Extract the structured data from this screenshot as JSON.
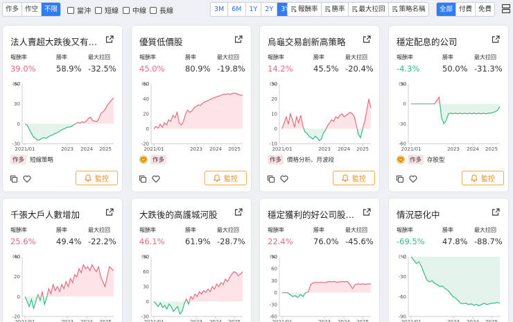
{
  "toolbar": {
    "direction": [
      {
        "label": "作多",
        "active": false
      },
      {
        "label": "作空",
        "active": false
      },
      {
        "label": "不限",
        "active": true
      }
    ],
    "terms": [
      "當沖",
      "短線",
      "中線",
      "長線"
    ],
    "periods": [
      {
        "label": "3M",
        "active": false
      },
      {
        "label": "6M",
        "active": false
      },
      {
        "label": "1Y",
        "active": false
      },
      {
        "label": "2Y",
        "active": false
      },
      {
        "label": "3Y",
        "active": true
      }
    ],
    "sorts": [
      "報酬率",
      "勝率",
      "最大拉回",
      "策略名稱"
    ],
    "pricing": [
      {
        "label": "全部",
        "active": true
      },
      {
        "label": "付費",
        "active": false
      },
      {
        "label": "免費",
        "active": false
      }
    ]
  },
  "labels": {
    "return": "報酬率",
    "winrate": "勝率",
    "drawdown": "最大拉回",
    "monitor": "監控",
    "unit": "(%)"
  },
  "colors": {
    "positive": "#e8697c",
    "negative": "#35b97e",
    "accent": "#2f7df6",
    "monitor": "#f4a742"
  },
  "cards": [
    {
      "title": "法人賣超大跌後又有法…",
      "return": "39.0%",
      "sign": "pos",
      "winrate": "58.9%",
      "drawdown": "-32.5%",
      "y_ticks": [
        "60",
        "30",
        "0",
        "-30"
      ],
      "y_range": [
        -30,
        60
      ],
      "x_ticks": [
        "2021/01",
        "2023",
        "2024",
        "2025"
      ],
      "series": [
        0,
        -2,
        -8,
        -14,
        -20,
        -22,
        -25,
        -24,
        -22,
        -21,
        -22,
        -20,
        -18,
        -17,
        -15,
        -14,
        -12,
        -10,
        -8,
        -7,
        -5,
        -5,
        -4,
        -2,
        0,
        2,
        1,
        3,
        2,
        4,
        8,
        10,
        5,
        4,
        3,
        8,
        16,
        18,
        22,
        28,
        32,
        36,
        39
      ],
      "tag": "作多",
      "tag_icon": false,
      "tag_desc": "短線策略"
    },
    {
      "title": "優質低價股",
      "return": "45.0%",
      "sign": "pos",
      "winrate": "80.9%",
      "drawdown": "-19.8%",
      "y_ticks": [
        "60",
        "40",
        "20",
        "0",
        "-20"
      ],
      "y_range": [
        -20,
        60
      ],
      "x_ticks": [
        "2021/01",
        "2023",
        "2024",
        "2025"
      ],
      "series": [
        0,
        3,
        1,
        6,
        2,
        8,
        5,
        12,
        10,
        18,
        15,
        22,
        8,
        5,
        10,
        20,
        25,
        22,
        24,
        28,
        30,
        32,
        31,
        34,
        36,
        37,
        38,
        40,
        41,
        42,
        43,
        44,
        45,
        46,
        46,
        47,
        46,
        47,
        48,
        47,
        46,
        45,
        45
      ],
      "tag": "作多",
      "tag_icon": true,
      "tag_desc": ""
    },
    {
      "title": "烏龜交易創新高策略",
      "return": "14.2%",
      "sign": "pos",
      "winrate": "45.5%",
      "drawdown": "-20.4%",
      "y_ticks": [
        "30",
        "20",
        "10",
        "0",
        "-10"
      ],
      "y_range": [
        -10,
        30
      ],
      "x_ticks": [
        "2021/01",
        "2023",
        "2024",
        "2025"
      ],
      "series": [
        0,
        4,
        8,
        3,
        10,
        6,
        1,
        8,
        4,
        9,
        2,
        -2,
        -3,
        -5,
        -6,
        -7,
        -5,
        -6,
        -8,
        -7,
        -3,
        -1,
        2,
        4,
        6,
        5,
        8,
        7,
        9,
        10,
        8,
        9,
        10,
        11,
        10,
        8,
        2,
        -4,
        -6,
        0,
        5,
        12,
        20,
        14
      ],
      "tag": "作多",
      "tag_icon": false,
      "tag_desc": "價格分析、月波段"
    },
    {
      "title": "穩定配息的公司",
      "return": "-4.3%",
      "sign": "neg",
      "winrate": "50.0%",
      "drawdown": "-31.3%",
      "y_ticks": [
        "30",
        "0",
        "-30",
        "-60"
      ],
      "y_range": [
        -60,
        30
      ],
      "x_ticks": [
        "2021/01",
        "2023",
        "2024",
        "2025"
      ],
      "series": [
        0,
        0,
        0,
        0,
        0,
        0,
        0,
        0,
        0,
        0,
        0,
        5,
        10,
        -20,
        -30,
        -25,
        -15,
        -14,
        -15,
        -14,
        -15,
        -14,
        -15,
        -14,
        -15,
        -14,
        -15,
        -14,
        -15,
        -14,
        -15,
        -14,
        -15,
        -14,
        -14,
        -13,
        -12,
        -10,
        -4
      ],
      "tag": "作多",
      "tag_icon": true,
      "tag_desc": "存股型"
    },
    {
      "title": "千張大戶人數增加",
      "return": "25.6%",
      "sign": "pos",
      "winrate": "49.4%",
      "drawdown": "-22.2%",
      "y_ticks": [
        "40",
        "20",
        "0",
        "-20"
      ],
      "y_range": [
        -20,
        40
      ],
      "x_ticks": [
        "2021/01",
        "2023",
        "2024",
        "2025"
      ],
      "series": [
        0,
        -5,
        -10,
        -3,
        -12,
        -5,
        2,
        -4,
        5,
        -8,
        -2,
        8,
        3,
        12,
        6,
        10,
        5,
        12,
        8,
        15,
        10,
        18,
        14,
        22,
        20,
        28,
        24,
        32,
        28,
        30,
        26,
        32,
        28,
        25,
        30,
        20,
        15,
        10,
        20,
        30,
        28,
        26
      ],
      "tag": "",
      "tag_icon": false,
      "tag_desc": ""
    },
    {
      "title": "大跌後的高護城河股",
      "return": "46.1%",
      "sign": "pos",
      "winrate": "61.9%",
      "drawdown": "-28.7%",
      "y_ticks": [
        "90",
        "60",
        "30",
        "0",
        "-30"
      ],
      "y_range": [
        -30,
        90
      ],
      "x_ticks": [
        "2021/01",
        "2023",
        "2024",
        "2025"
      ],
      "series": [
        0,
        -5,
        -10,
        -3,
        -12,
        -8,
        -15,
        -5,
        -10,
        -20,
        -15,
        -10,
        -25,
        -20,
        -5,
        5,
        -5,
        10,
        5,
        15,
        10,
        20,
        15,
        22,
        18,
        25,
        20,
        30,
        25,
        35,
        30,
        38,
        34,
        45,
        40,
        48,
        55,
        60,
        58,
        52,
        55,
        60
      ],
      "tag": "",
      "tag_icon": false,
      "tag_desc": ""
    },
    {
      "title": "穩定獲利的好公司股價…",
      "return": "22.4%",
      "sign": "pos",
      "winrate": "76.0%",
      "drawdown": "-45.6%",
      "y_ticks": [
        "90",
        "60",
        "30",
        "0",
        "-30",
        "-60"
      ],
      "y_range": [
        -60,
        90
      ],
      "x_ticks": [
        "2021/01",
        "2023",
        "2024",
        "2025"
      ],
      "series": [
        0,
        0,
        0,
        -5,
        -10,
        -8,
        -12,
        -5,
        -10,
        0,
        2,
        20,
        25,
        26,
        25,
        26,
        25,
        26,
        28,
        27,
        28,
        26,
        27,
        28,
        27,
        28,
        20,
        10,
        20,
        22,
        21,
        22,
        21,
        22,
        22
      ],
      "tag": "",
      "tag_icon": false,
      "tag_desc": ""
    },
    {
      "title": "情況惡化中",
      "return": "-69.5%",
      "sign": "neg",
      "winrate": "47.8%",
      "drawdown": "-88.7%",
      "y_ticks": [
        "0",
        "-30",
        "-60",
        "-90"
      ],
      "y_range": [
        -90,
        0
      ],
      "x_ticks": [
        "2021/01",
        "2023",
        "2024",
        "2025"
      ],
      "series": [
        0,
        -5,
        -10,
        -8,
        -15,
        -25,
        -35,
        -38,
        -36,
        -40,
        -42,
        -45,
        -44,
        -48,
        -50,
        -55,
        -60,
        -62,
        -66,
        -70,
        -71,
        -70,
        -72,
        -71,
        -73,
        -72,
        -74,
        -72,
        -70,
        -72,
        -71,
        -70,
        -70,
        -69,
        -70
      ],
      "tag": "",
      "tag_icon": false,
      "tag_desc": ""
    }
  ]
}
